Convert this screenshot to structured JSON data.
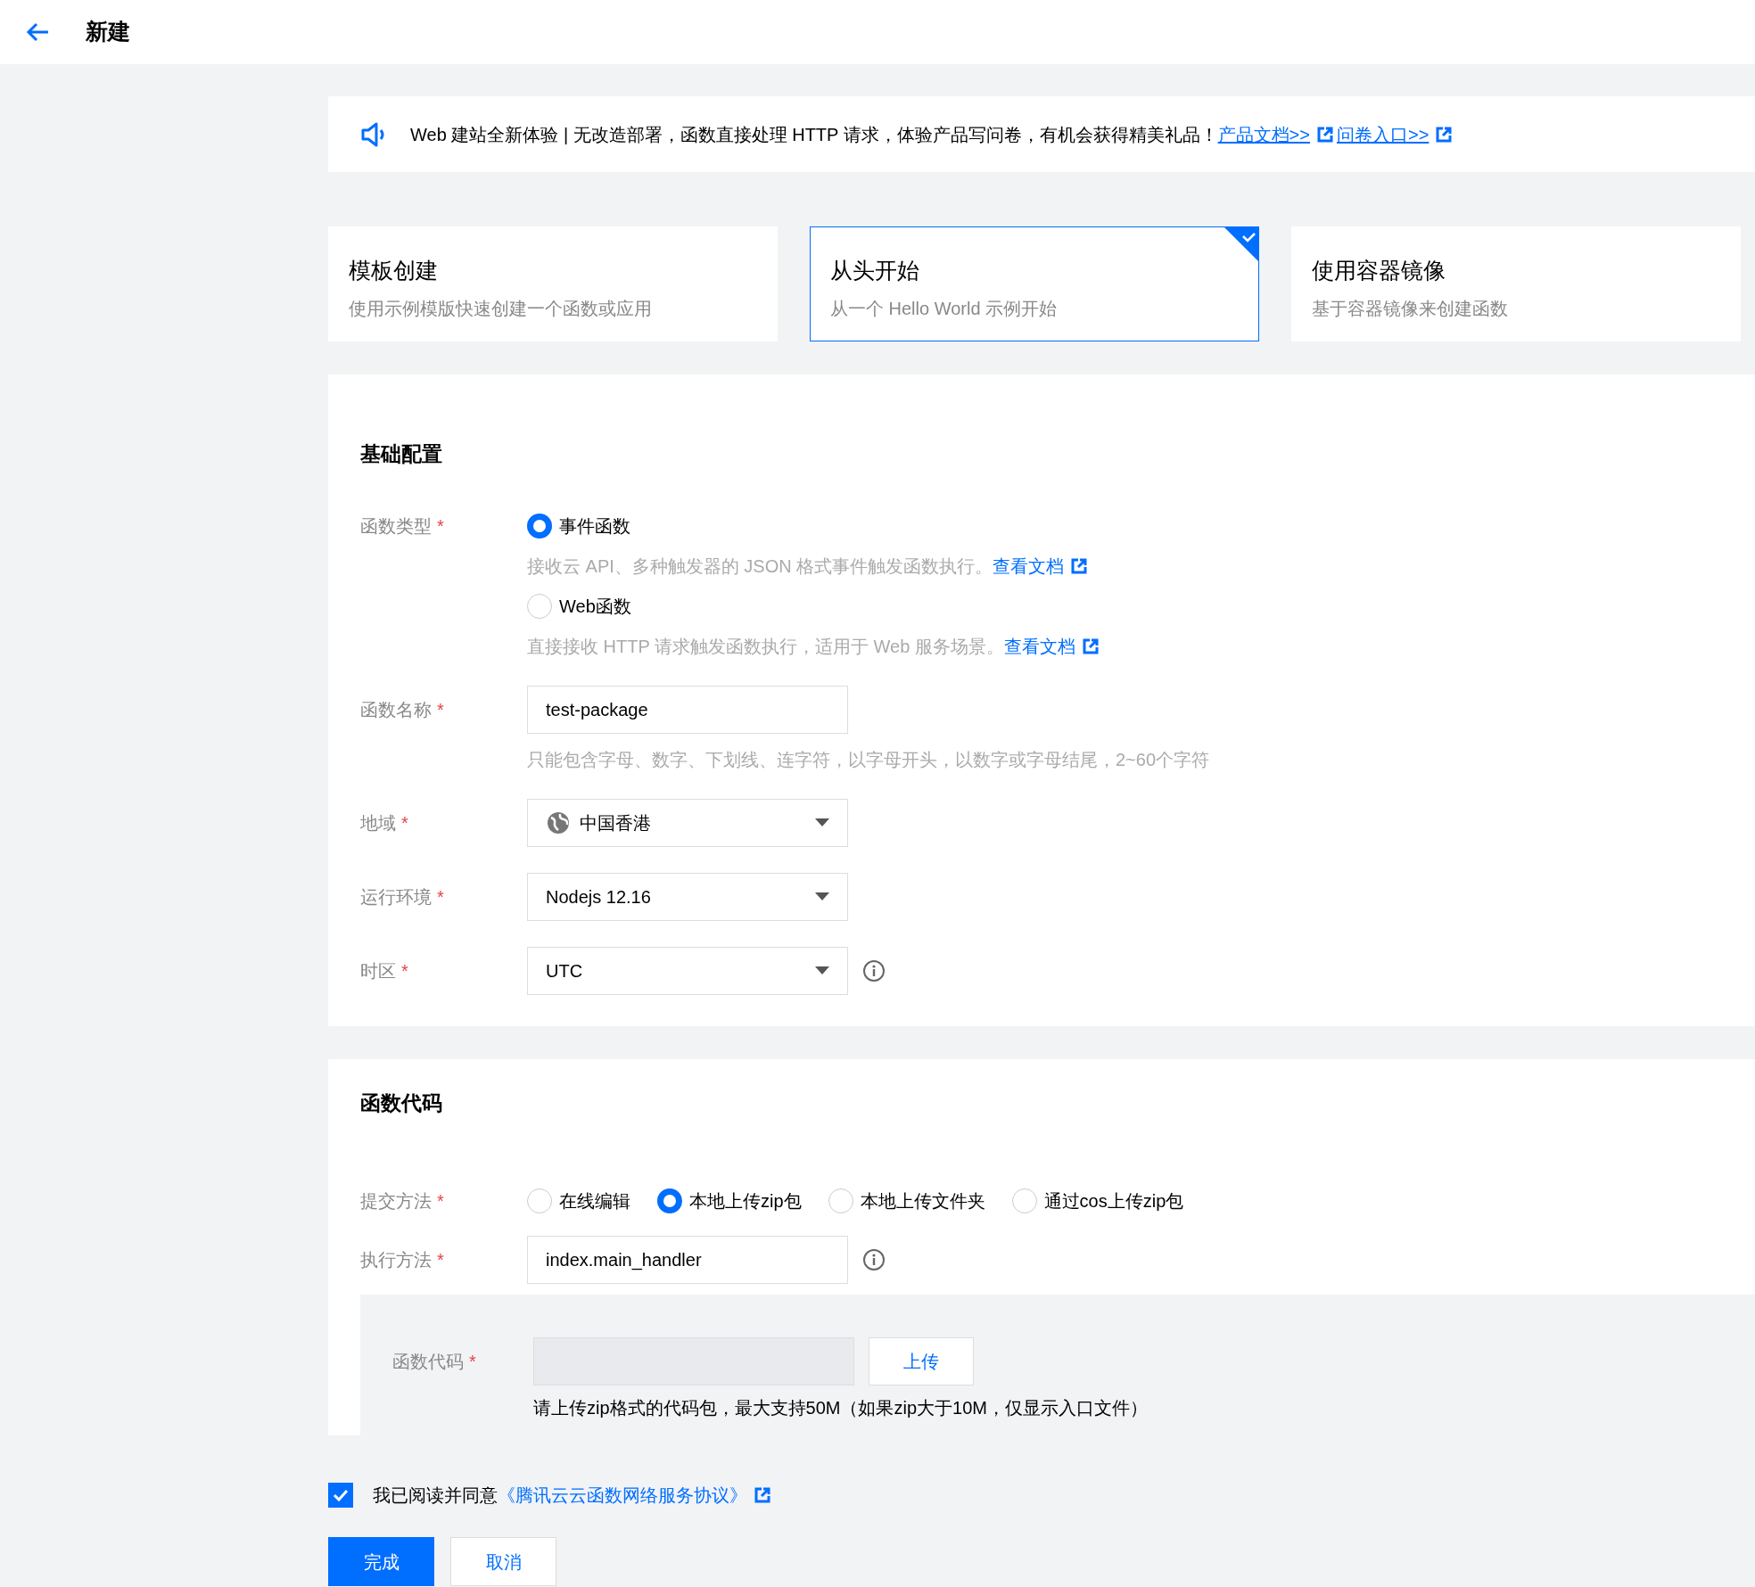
{
  "header": {
    "title": "新建"
  },
  "notice": {
    "text": "Web 建站全新体验 | 无改造部署，函数直接处理 HTTP 请求，体验产品写问卷，有机会获得精美礼品！",
    "links": [
      "产品文档>>",
      "问卷入口>>"
    ]
  },
  "create_modes": [
    {
      "title": "模板创建",
      "description": "使用示例模版快速创建一个函数或应用",
      "selected": false
    },
    {
      "title": "从头开始",
      "description": "从一个 Hello World 示例开始",
      "selected": true
    },
    {
      "title": "使用容器镜像",
      "description": "基于容器镜像来创建函数",
      "selected": false
    }
  ],
  "basic_config": {
    "title": "基础配置",
    "fields": [
      {
        "kind": "radio_stack",
        "label": "函数类型",
        "required_mark": "*",
        "options": [
          {
            "label": "事件函数",
            "selected": true,
            "description": "接收云 API、多种触发器的 JSON 格式事件触发函数执行。",
            "link": "查看文档"
          },
          {
            "label": "Web函数",
            "selected": false,
            "description": "直接接收 HTTP 请求触发函数执行，适用于 Web 服务场景。",
            "link": "查看文档"
          }
        ]
      },
      {
        "kind": "input",
        "label": "函数名称",
        "required_mark": "*",
        "value": "test-package",
        "hint": "只能包含字母、数字、下划线、连字符，以字母开头，以数字或字母结尾，2~60个字符"
      },
      {
        "kind": "region_select",
        "label": "地域",
        "required_mark": "*",
        "value": "中国香港"
      },
      {
        "kind": "select",
        "label": "运行环境",
        "required_mark": "*",
        "value": "Nodejs 12.16"
      },
      {
        "kind": "select",
        "label": "时区",
        "required_mark": "*",
        "value": "UTC",
        "info": true
      }
    ]
  },
  "function_code": {
    "title": "函数代码",
    "fields": [
      {
        "kind": "radio_row",
        "label": "提交方法",
        "required_mark": "*",
        "options": [
          {
            "label": "在线编辑",
            "selected": false
          },
          {
            "label": "本地上传zip包",
            "selected": true
          },
          {
            "label": "本地上传文件夹",
            "selected": false
          },
          {
            "label": "通过cos上传zip包",
            "selected": false
          }
        ]
      },
      {
        "kind": "input",
        "label": "执行方法",
        "required_mark": "*",
        "value": "index.main_handler",
        "info": true
      }
    ],
    "upload": {
      "label": "函数代码",
      "required_mark": "*",
      "button": "上传",
      "hint": "请上传zip格式的代码包，最大支持50M（如果zip大于10M，仅显示入口文件）"
    }
  },
  "agreement": {
    "checked": true,
    "text": "我已阅读并同意",
    "link": "《腾讯云云函数网络服务协议》"
  },
  "buttons": [
    {
      "label": "完成",
      "kind": "primary"
    },
    {
      "label": "取消",
      "kind": "secondary"
    }
  ]
}
